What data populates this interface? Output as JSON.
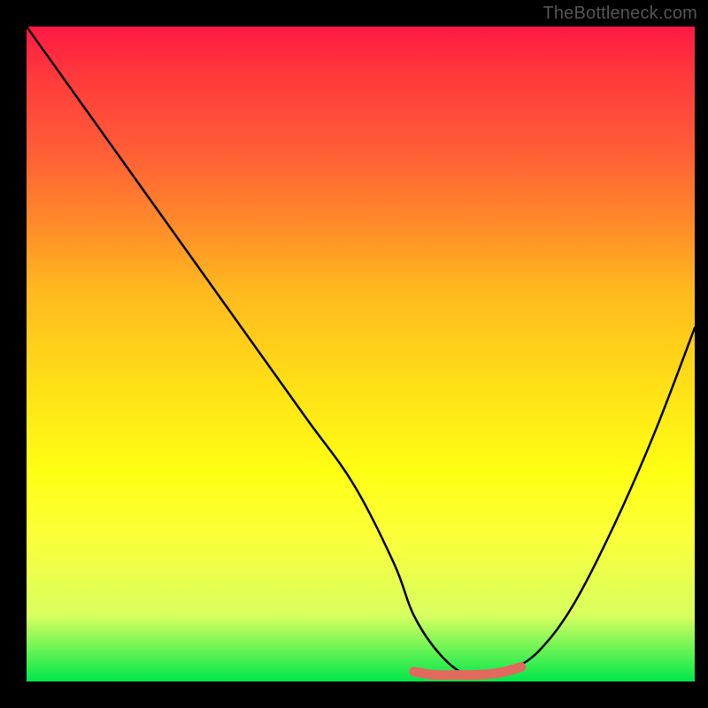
{
  "watermark": "TheBottleneck.com",
  "chart_data": {
    "type": "line",
    "title": "",
    "xlabel": "",
    "ylabel": "",
    "xlim": [
      0,
      100
    ],
    "ylim": [
      0,
      100
    ],
    "grid": false,
    "legend": false,
    "gradient_stops": [
      {
        "pos": 0,
        "color": "#ff1a44"
      },
      {
        "pos": 8,
        "color": "#ff3b3b"
      },
      {
        "pos": 18,
        "color": "#ff5a38"
      },
      {
        "pos": 30,
        "color": "#ff8a2a"
      },
      {
        "pos": 40,
        "color": "#ffb81f"
      },
      {
        "pos": 55,
        "color": "#ffe016"
      },
      {
        "pos": 68,
        "color": "#ffff14"
      },
      {
        "pos": 78,
        "color": "#faff3a"
      },
      {
        "pos": 90,
        "color": "#d8ff60"
      },
      {
        "pos": 100,
        "color": "#00e84a"
      }
    ],
    "series": [
      {
        "name": "curve",
        "color": "#000000",
        "x": [
          0,
          7,
          14,
          21,
          28,
          35,
          42,
          49,
          55,
          58,
          62,
          66,
          70,
          73,
          77,
          82,
          88,
          94,
          100
        ],
        "y": [
          100,
          90,
          80,
          70,
          60,
          50,
          40,
          30,
          18,
          10,
          4,
          1,
          1,
          2,
          5,
          12,
          24,
          38,
          54
        ]
      },
      {
        "name": "highlight",
        "color": "#e2695e",
        "x": [
          58,
          61,
          64,
          67,
          70,
          72,
          74
        ],
        "y": [
          1.5,
          1,
          1,
          1,
          1.2,
          1.6,
          2.2
        ]
      }
    ],
    "annotations": []
  }
}
